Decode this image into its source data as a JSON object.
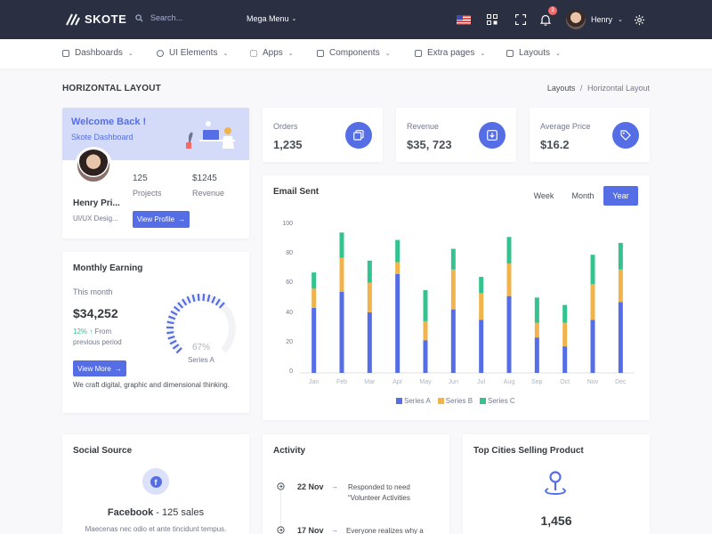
{
  "brand": {
    "name": "SKOTE"
  },
  "topbar": {
    "search_placeholder": "Search...",
    "mega_menu": "Mega Menu",
    "notification_count": "3",
    "user_name": "Henry",
    "icons": [
      "flag-us-icon",
      "apps-grid-icon",
      "fullscreen-icon",
      "bell-icon",
      "gear-icon"
    ]
  },
  "menu": [
    {
      "label": "Dashboards",
      "icon": "home-icon"
    },
    {
      "label": "UI Elements",
      "icon": "palette-icon"
    },
    {
      "label": "Apps",
      "icon": "apps-icon"
    },
    {
      "label": "Components",
      "icon": "briefcase-icon"
    },
    {
      "label": "Extra pages",
      "icon": "file-icon"
    },
    {
      "label": "Layouts",
      "icon": "layout-icon"
    }
  ],
  "page": {
    "title": "HORIZONTAL LAYOUT",
    "breadcrumb": [
      "Layouts",
      "/",
      "Horizontal Layout"
    ]
  },
  "welcome": {
    "title": "Welcome Back !",
    "subtitle": "Skote Dashboard",
    "name": "Henry Pri...",
    "role": "UI/UX Desig...",
    "projects_value": "125",
    "projects_label": "Projects",
    "revenue_value": "$1245",
    "revenue_label": "Revenue",
    "button": "View Profile"
  },
  "earning": {
    "title": "Monthly Earning",
    "period": "This month",
    "amount": "$34,252",
    "growth": "12%",
    "growth_text": "From previous period",
    "button": "View More",
    "gauge_value": "67%",
    "gauge_fraction": 0.67,
    "gauge_label": "Series A",
    "description": "We craft digital, graphic and dimensional thinking."
  },
  "mini_stats": [
    {
      "title": "Orders",
      "value": "1,235",
      "icon": "copy-icon"
    },
    {
      "title": "Revenue",
      "value": "$35, 723",
      "icon": "archive-icon"
    },
    {
      "title": "Average Price",
      "value": "$16.2",
      "icon": "tag-icon"
    }
  ],
  "email": {
    "title": "Email Sent",
    "tabs": [
      "Week",
      "Month",
      "Year"
    ],
    "active_tab": "Year"
  },
  "chart_data": {
    "type": "bar",
    "stacked": true,
    "categories": [
      "Jan",
      "Feb",
      "Mar",
      "Apr",
      "May",
      "Jun",
      "Jul",
      "Aug",
      "Sep",
      "Oct",
      "Nov",
      "Dec"
    ],
    "series": [
      {
        "name": "Series A",
        "color": "#556ee6",
        "values": [
          44,
          55,
          41,
          67,
          22,
          43,
          36,
          52,
          24,
          18,
          36,
          48
        ]
      },
      {
        "name": "Series B",
        "color": "#f1b44c",
        "values": [
          13,
          23,
          20,
          8,
          13,
          27,
          18,
          22,
          10,
          16,
          24,
          22
        ]
      },
      {
        "name": "Series C",
        "color": "#34c38f",
        "values": [
          11,
          17,
          15,
          15,
          21,
          14,
          11,
          18,
          17,
          12,
          20,
          18
        ]
      }
    ],
    "yticks": [
      "100",
      "80",
      "60",
      "40",
      "20",
      "0"
    ],
    "ylim": [
      0,
      100
    ],
    "legend_position": "bottom"
  },
  "social": {
    "title": "Social Source",
    "network": "Facebook",
    "sales": "125 sales",
    "text": "Maecenas nec odio et ante tincidunt tempus."
  },
  "activity": {
    "title": "Activity",
    "items": [
      {
        "date": "22 Nov",
        "text": "Responded to need “Volunteer Activities"
      },
      {
        "date": "17 Nov",
        "text": "Everyone realizes why a"
      }
    ]
  },
  "cities": {
    "title": "Top Cities Selling Product",
    "value": "1,456"
  }
}
